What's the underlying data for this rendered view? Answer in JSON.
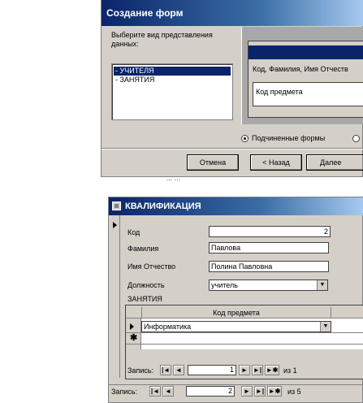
{
  "wizard": {
    "title": "Создание форм",
    "prompt": "Выберите вид представления данных:",
    "list_items": [
      "- УЧИТЕЛЯ",
      "- ЗАНЯТИЯ"
    ],
    "selected_index": 0,
    "preview_fields": "Код, Фамилия, Имя Отчеств",
    "preview_subform": "Код предмета",
    "radio_subforms_label": "Подчиненные формы",
    "radio_subforms_checked": true,
    "buttons": {
      "cancel": "Отмена",
      "back": "< Назад",
      "next": "Далее"
    }
  },
  "caption": "... ...",
  "form": {
    "title": "КВАЛИФИКАЦИЯ",
    "fields": {
      "kod_label": "Код",
      "kod_value": "2",
      "familia_label": "Фамилия",
      "familia_value": "Павлова",
      "io_label": "Имя Отчество",
      "io_value": "Полина Павловна",
      "dolzh_label": "Должность",
      "dolzh_value": "учитель"
    },
    "subform_label": "ЗАНЯТИЯ",
    "subform": {
      "column_header": "Код предмета",
      "rows": [
        "Информатика"
      ],
      "nav": {
        "label": "Запись:",
        "current": "1",
        "of_label": "из 1"
      }
    },
    "nav": {
      "label": "Запись:",
      "current": "2",
      "of_label": "из 5"
    }
  }
}
